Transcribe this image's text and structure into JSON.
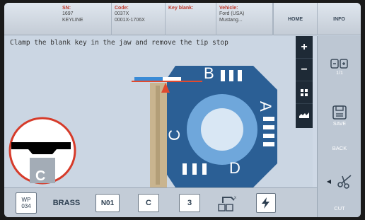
{
  "header": {
    "sn": {
      "label": "SN:",
      "line1": "1697",
      "line2": "KEYLINE"
    },
    "code": {
      "label": "Code:",
      "line1": "0037X",
      "line2": "0001X-1706X"
    },
    "key_blank": {
      "label": "Key blank:"
    },
    "vehicle": {
      "label": "Vehicle:",
      "line1": "Ford (USA)",
      "line2": "Mustang..."
    },
    "home_label": "HOME",
    "info_label": "INFO"
  },
  "instruction": "Clamp the blank key in the jaw and remove the tip stop",
  "jaw": {
    "side_letters": [
      "A",
      "B",
      "C",
      "D"
    ],
    "zoom_letter": "C"
  },
  "zoom_buttons": [
    "+",
    "−"
  ],
  "right_panel": {
    "counter": "1/1",
    "save_label": "SAVE",
    "back_label": "BACK",
    "cut_label": "CUT"
  },
  "bottom_bar": {
    "profile_line1": "WP",
    "profile_line2": "034",
    "material": "BRASS",
    "n_code": "N01",
    "jaw_side": "C",
    "step": "3"
  },
  "colors": {
    "accent_red": "#e04a2f",
    "accent_blue": "#3a8bd6",
    "panel_dark": "#1e2a36"
  }
}
